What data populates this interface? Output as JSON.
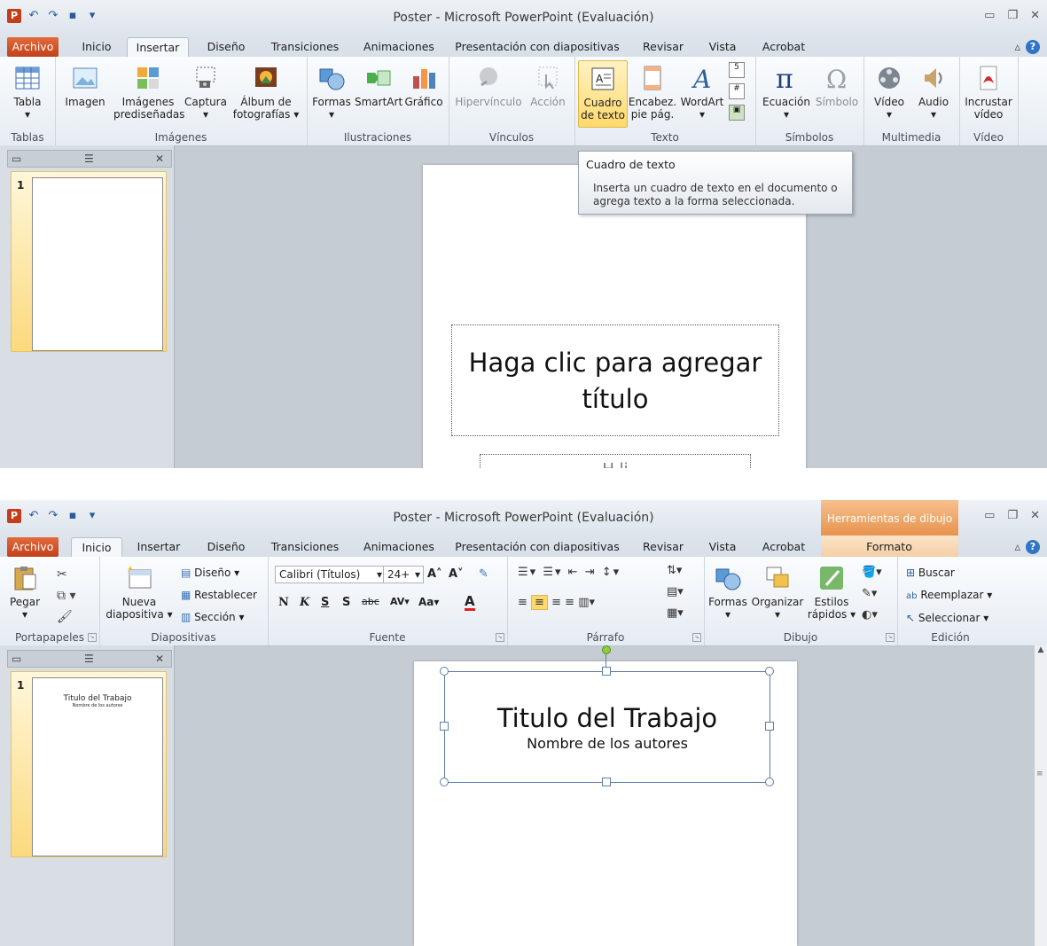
{
  "window": {
    "title": "Poster - Microsoft PowerPoint (Evaluación)"
  },
  "tabs": {
    "archivo": "Archivo",
    "inicio": "Inicio",
    "insertar": "Insertar",
    "diseno": "Diseño",
    "transiciones": "Transiciones",
    "animaciones": "Animaciones",
    "presentacion": "Presentación con diapositivas",
    "revisar": "Revisar",
    "vista": "Vista",
    "acrobat": "Acrobat",
    "formato": "Formato",
    "herramientas": "Herramientas de dibujo"
  },
  "insert_ribbon": {
    "tabla": "Tabla",
    "imagen": "Imagen",
    "imagenes_1": "Imágenes",
    "imagenes_2": "prediseñadas",
    "captura": "Captura",
    "album_1": "Álbum de",
    "album_2": "fotografías",
    "formas": "Formas",
    "smartart": "SmartArt",
    "grafico": "Gráfico",
    "hipervinculo": "Hipervínculo",
    "accion": "Acción",
    "cuadro_1": "Cuadro",
    "cuadro_2": "de texto",
    "encabez_1": "Encabez.",
    "encabez_2": "pie pág.",
    "wordart": "WordArt",
    "ecuacion": "Ecuación",
    "simbolo": "Símbolo",
    "video": "Vídeo",
    "audio": "Audio",
    "incrustar_1": "Incrustar",
    "incrustar_2": "vídeo",
    "g_tablas": "Tablas",
    "g_imagenes": "Imágenes",
    "g_ilustraciones": "Ilustraciones",
    "g_vinculos": "Vínculos",
    "g_texto": "Texto",
    "g_simbolos": "Símbolos",
    "g_multimedia": "Multimedia",
    "g_video": "Vídeo"
  },
  "tooltip": {
    "title": "Cuadro de texto",
    "line1": "Inserta un cuadro de texto en el documento o",
    "line2": "agrega texto a la forma seleccionada."
  },
  "slide1": {
    "thumb_num": "1",
    "title_line1": "Haga clic para agregar",
    "title_line2": "título",
    "subtitle_partial": "H       li"
  },
  "home_ribbon": {
    "pegar": "Pegar",
    "nueva_1": "Nueva",
    "nueva_2": "diapositiva",
    "diseno": "Diseño",
    "restablecer": "Restablecer",
    "seccion": "Sección",
    "font_name": "Calibri (Títulos)",
    "font_size": "24+",
    "formas": "Formas",
    "organizar": "Organizar",
    "estilos_1": "Estilos",
    "estilos_2": "rápidos",
    "buscar": "Buscar",
    "reemplazar": "Reemplazar",
    "seleccionar": "Seleccionar",
    "g_portapapeles": "Portapapeles",
    "g_diapositivas": "Diapositivas",
    "g_fuente": "Fuente",
    "g_parrafo": "Párrafo",
    "g_dibujo": "Dibujo",
    "g_edicion": "Edición"
  },
  "slide2": {
    "thumb_num": "1",
    "thumb_title": "Titulo del Trabajo",
    "thumb_sub": "Nombre de los autores",
    "title": "Titulo del Trabajo",
    "subtitle": "Nombre de los autores"
  },
  "colors": {
    "accent_orange": "#c1411b",
    "context_orange": "#e8934e",
    "highlight": "#ffd96b"
  }
}
